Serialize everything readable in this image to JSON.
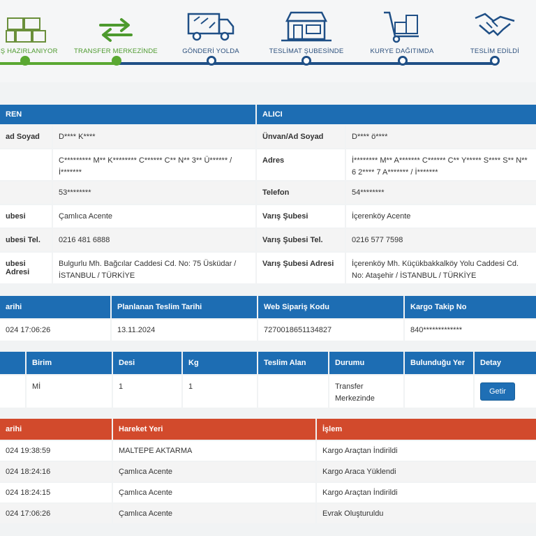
{
  "tracker": {
    "steps": [
      {
        "label": "KIŞ HAZIRLANIYOR",
        "icon": "package-icon",
        "status": "done"
      },
      {
        "label": "TRANSFER MERKEZİNDE",
        "icon": "transfer-arrows-icon",
        "status": "done"
      },
      {
        "label": "GÖNDERİ YOLDA",
        "icon": "truck-icon",
        "status": "pending"
      },
      {
        "label": "TESLİMAT ŞUBESİNDE",
        "icon": "branch-store-icon",
        "status": "pending"
      },
      {
        "label": "KURYE DAĞITIMDA",
        "icon": "hand-truck-icon",
        "status": "pending"
      },
      {
        "label": "TESLİM EDİLDİ",
        "icon": "handshake-icon",
        "status": "pending"
      }
    ],
    "colors": {
      "done": "#5aa832",
      "pending": "#1f4f86"
    }
  },
  "sender": {
    "header": "REN",
    "rows": [
      {
        "label": "ad Soyad",
        "value": "D**** K****"
      },
      {
        "label": "",
        "value": "C********* M** K******** C****** C** N** 3** Ü****** / İ*******"
      },
      {
        "label": "",
        "value": "53********"
      },
      {
        "label": "ubesi",
        "value": "Çamlıca Acente"
      },
      {
        "label": "ubesi Tel.",
        "value": "0216 481 6888"
      },
      {
        "label": "ubesi Adresi",
        "value": "Bulgurlu Mh. Bağcılar Caddesi Cd. No: 75 Üsküdar / İSTANBUL / TÜRKİYE"
      }
    ]
  },
  "receiver": {
    "header": "ALICI",
    "rows": [
      {
        "label": "Ünvan/Ad Soyad",
        "value": "D**** ö****"
      },
      {
        "label": "Adres",
        "value": "İ******** M** A******* C****** C** Y***** S**** S** N** 6 2**** 7 A******* / İ*******"
      },
      {
        "label": "Telefon",
        "value": "54********"
      },
      {
        "label": "Varış Şubesi",
        "value": "İçerenköy Acente"
      },
      {
        "label": "Varış Şubesi Tel.",
        "value": "0216 577 7598"
      },
      {
        "label": "Varış Şubesi Adresi",
        "value": "İçerenköy Mh. Küçükbakkalköy Yolu Caddesi Cd. No: Ataşehir / İSTANBUL / TÜRKİYE"
      }
    ]
  },
  "order": {
    "headers": [
      "arihi",
      "Planlanan Teslim Tarihi",
      "Web Sipariş Kodu",
      "Kargo Takip No"
    ],
    "values": [
      "024 17:06:26",
      "13.11.2024",
      "7270018651134827",
      "840*************"
    ]
  },
  "package": {
    "headers": [
      "",
      "Birim",
      "Desi",
      "Kg",
      "Teslim Alan",
      "Durumu",
      "Bulunduğu Yer",
      "Detay"
    ],
    "values": [
      "",
      "Mİ",
      "1",
      "1",
      "",
      "Transfer Merkezinde",
      "",
      ""
    ],
    "detail_button": "Getir"
  },
  "movements": {
    "headers": [
      "arihi",
      "Hareket Yeri",
      "İşlem"
    ],
    "rows": [
      [
        "024 19:38:59",
        "MALTEPE AKTARMA",
        "Kargo Araçtan İndirildi"
      ],
      [
        "024 18:24:16",
        "Çamlıca Acente",
        "Kargo Araca Yüklendi"
      ],
      [
        "024 18:24:15",
        "Çamlıca Acente",
        "Kargo Araçtan İndirildi"
      ],
      [
        "024 17:06:26",
        "Çamlıca Acente",
        "Evrak Oluşturuldu"
      ]
    ]
  }
}
